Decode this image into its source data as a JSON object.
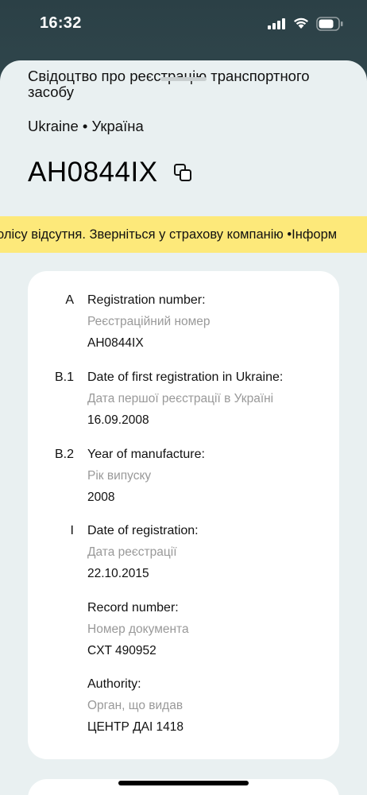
{
  "status_bar": {
    "time": "16:32"
  },
  "document": {
    "title": "Свідоцтво про реєстрацію транспортного засобу",
    "country": "Ukraine • Україна",
    "plate": "AH0844IX"
  },
  "ticker": {
    "text": "олісу відсутня. Зверніться у страхову компанію •Інформ"
  },
  "fields": [
    {
      "code": "A",
      "label": "Registration number:",
      "sub": "Реєстраційний номер",
      "value": "AH0844IX"
    },
    {
      "code": "B.1",
      "label": "Date of first registration in Ukraine:",
      "sub": "Дата першої реєстрації в Україні",
      "value": "16.09.2008"
    },
    {
      "code": "B.2",
      "label": "Year of manufacture:",
      "sub": "Рік випуску",
      "value": "2008"
    },
    {
      "code": "I",
      "label": "Date of registration:",
      "sub": "Дата реєстрації",
      "value": "22.10.2015"
    },
    {
      "code": "",
      "label": "Record number:",
      "sub": "Номер документа",
      "value": "CXT 490952"
    },
    {
      "code": "",
      "label": "Authority:",
      "sub": "Орган, що видав",
      "value": "ЦЕНТР ДАІ 1418"
    }
  ],
  "icons": {
    "signal": "cellular-signal-icon",
    "wifi": "wifi-icon",
    "battery": "battery-icon",
    "copy": "copy-icon"
  },
  "colors": {
    "ticker_bg": "#fde97a",
    "sheet_bg": "#e9f0f1",
    "secondary_text": "#999999"
  }
}
